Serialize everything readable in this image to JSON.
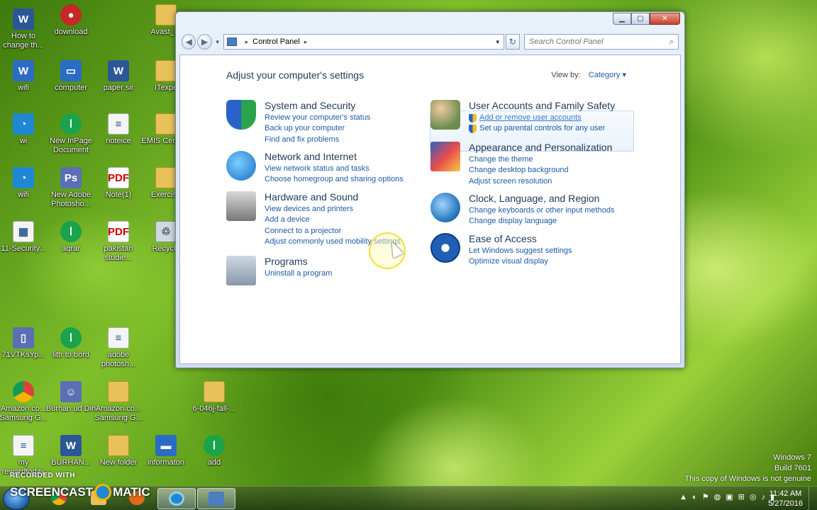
{
  "desktop": {
    "icons": [
      {
        "label": "How to change th...",
        "icon": "word-doc-icon",
        "glyph": "W"
      },
      {
        "label": "download",
        "icon": "app-icon",
        "glyph": "●"
      },
      {
        "label": "Avast_re",
        "icon": "folder-icon",
        "glyph": ""
      },
      {
        "label": "wifi",
        "icon": "wifi-app-icon",
        "glyph": "W"
      },
      {
        "label": "computer",
        "icon": "computer-icon",
        "glyph": "▭"
      },
      {
        "label": "paper sir",
        "icon": "word-doc-icon",
        "glyph": "W"
      },
      {
        "label": "ITexpe",
        "icon": "folder-icon",
        "glyph": ""
      },
      {
        "label": "wi",
        "icon": "wifi-icon",
        "glyph": "◔"
      },
      {
        "label": "New InPage Document",
        "icon": "inpage-icon",
        "glyph": "ا"
      },
      {
        "label": "noteice",
        "icon": "text-doc-icon",
        "glyph": "≡"
      },
      {
        "label": "EMIS Centera",
        "icon": "folder-icon",
        "glyph": ""
      },
      {
        "label": "wifi",
        "icon": "wifi-icon",
        "glyph": "◔"
      },
      {
        "label": "New Adobe Photosho...",
        "icon": "photoshop-icon",
        "glyph": "Ps"
      },
      {
        "label": "Note(1)",
        "icon": "pdf-icon",
        "glyph": "PDF"
      },
      {
        "label": "Exercise",
        "icon": "folder-icon",
        "glyph": ""
      },
      {
        "label": "11-Security...",
        "icon": "spreadsheet-icon",
        "glyph": "▦"
      },
      {
        "label": "aqrar",
        "icon": "inpage-icon",
        "glyph": "ا"
      },
      {
        "label": "pakistan studie...",
        "icon": "pdf-icon",
        "glyph": "PDF"
      },
      {
        "label": "Recycle",
        "icon": "recycle-bin-icon",
        "glyph": "♲"
      },
      {
        "label": "71VTKsYp...",
        "icon": "phone-image-icon",
        "glyph": "▯"
      },
      {
        "label": "littr to bord",
        "icon": "inpage-icon",
        "glyph": "ا"
      },
      {
        "label": "adobe photosh...",
        "icon": "text-doc-icon",
        "glyph": "≡"
      },
      {
        "label": "Amazon.co... Samsung G...",
        "icon": "chrome-icon",
        "glyph": ""
      },
      {
        "label": "Burhan ud Din",
        "icon": "photo-icon",
        "glyph": "☺"
      },
      {
        "label": "Amazon.co... Samsung G...",
        "icon": "archive-icon",
        "glyph": ""
      },
      {
        "label": "6-046j-fall-...",
        "icon": "archive-icon",
        "glyph": ""
      },
      {
        "label": "my rewardtoday",
        "icon": "text-doc-icon",
        "glyph": "≡"
      },
      {
        "label": "BURHAN...",
        "icon": "word-doc-icon",
        "glyph": "W"
      },
      {
        "label": "New folder",
        "icon": "folder-icon",
        "glyph": ""
      },
      {
        "label": "informaton",
        "icon": "device-icon",
        "glyph": "▬"
      },
      {
        "label": "add",
        "icon": "inpage-icon",
        "glyph": "ا"
      }
    ]
  },
  "window": {
    "minimize": "▁",
    "maximize": "▢",
    "close": "✕",
    "back": "◀",
    "forward": "▶",
    "address": {
      "crumb": "Control Panel",
      "separator": "▸"
    },
    "refresh": "↻",
    "search_placeholder": "Search Control Panel",
    "search_icon": "⌕"
  },
  "control_panel": {
    "heading": "Adjust your computer's settings",
    "view_by_label": "View by:",
    "view_by_value": "Category ▾",
    "categories_left": [
      {
        "title": "System and Security",
        "icon": "shield-icon",
        "links": [
          "Review your computer's status",
          "Back up your computer",
          "Find and fix problems"
        ]
      },
      {
        "title": "Network and Internet",
        "icon": "network-icon",
        "links": [
          "View network status and tasks",
          "Choose homegroup and sharing options"
        ]
      },
      {
        "title": "Hardware and Sound",
        "icon": "printer-icon",
        "links": [
          "View devices and printers",
          "Add a device",
          "Connect to a projector",
          "Adjust commonly used mobility settings"
        ]
      },
      {
        "title": "Programs",
        "icon": "programs-icon",
        "links": [
          "Uninstall a program"
        ]
      }
    ],
    "categories_right": [
      {
        "title": "User Accounts and Family Safety",
        "icon": "users-icon",
        "links": [
          "Add or remove user accounts",
          "Set up parental controls for any user"
        ]
      },
      {
        "title": "Appearance and Personalization",
        "icon": "appearance-icon",
        "links": [
          "Change the theme",
          "Change desktop background",
          "Adjust screen resolution"
        ]
      },
      {
        "title": "Clock, Language, and Region",
        "icon": "globe-clock-icon",
        "links": [
          "Change keyboards or other input methods",
          "Change display language"
        ]
      },
      {
        "title": "Ease of Access",
        "icon": "ease-of-access-icon",
        "links": [
          "Let Windows suggest settings",
          "Optimize visual display"
        ]
      }
    ]
  },
  "watermark": {
    "recorded": "RECORDED WITH",
    "screencast_left": "SCREENCAST",
    "screencast_right": "MATIC"
  },
  "genuine": {
    "line1": "Windows 7",
    "line2": "Build 7601",
    "line3": "This copy of Windows is not genuine"
  },
  "taskbar": {
    "time": "11:42 AM",
    "date": "5/27/2016",
    "tray_icons": [
      "▲",
      "◐",
      "⚑",
      "◍",
      "▣",
      "⊞",
      "◎",
      "♪",
      "▮"
    ]
  },
  "colors": {
    "link": "#1e5aa8",
    "title": "#1e395b"
  }
}
